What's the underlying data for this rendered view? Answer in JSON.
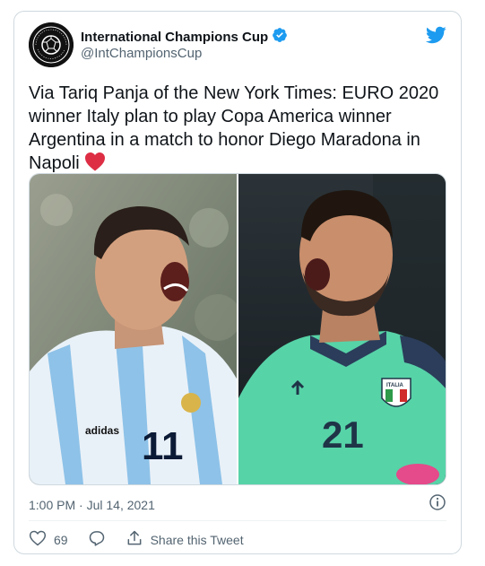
{
  "author": {
    "display_name": "International Champions Cup",
    "handle": "@IntChampionsCup",
    "avatar_icon": "icc-logo",
    "verified": true
  },
  "tweet": {
    "text": "Via Tariq Panja of the New York Times: EURO 2020 winner Italy plan to play Copa America winner Argentina in a match to honor Diego Maradona in Napoli",
    "emoji": "red-heart"
  },
  "media": {
    "left_jersey_number": "11",
    "left_brand": "adidas",
    "right_jersey_number": "21",
    "right_badge": "ITALIA"
  },
  "meta": {
    "timestamp": "1:00 PM · Jul 14, 2021"
  },
  "actions": {
    "likes_count": "69",
    "share_label": "Share this Tweet"
  },
  "colors": {
    "twitter_blue": "#1d9bf0",
    "text_secondary": "#536471",
    "heart_red": "#e0245e"
  }
}
